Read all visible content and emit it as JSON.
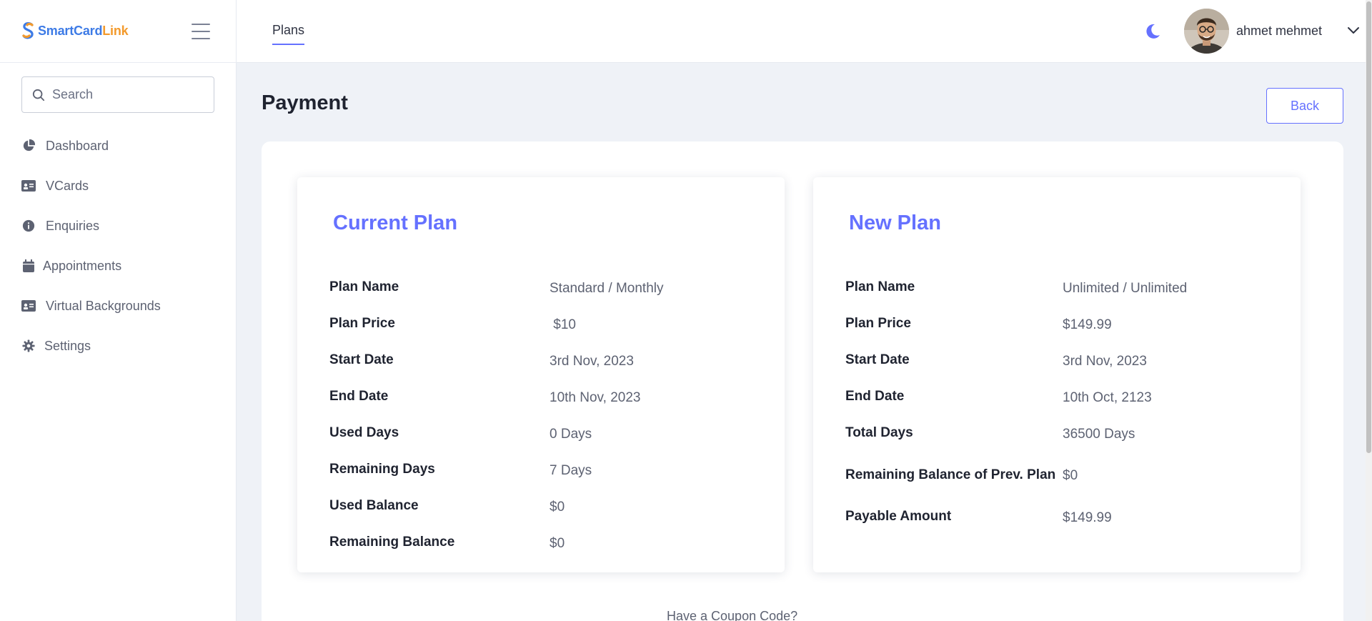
{
  "brand": {
    "part1": "Smart",
    "part2": "Card",
    "part3": "Link"
  },
  "search": {
    "placeholder": "Search"
  },
  "sidebar": {
    "items": [
      {
        "label": "Dashboard",
        "icon": "pie-chart-icon"
      },
      {
        "label": "VCards",
        "icon": "id-card-icon"
      },
      {
        "label": "Enquiries",
        "icon": "info-circle-icon"
      },
      {
        "label": "Appointments",
        "icon": "calendar-icon"
      },
      {
        "label": "Virtual Backgrounds",
        "icon": "id-card-icon"
      },
      {
        "label": "Settings",
        "icon": "gear-icon"
      }
    ]
  },
  "header": {
    "tab": "Plans",
    "user_name": "ahmet mehmet"
  },
  "page": {
    "title": "Payment",
    "back_label": "Back",
    "coupon_text": "Have a Coupon Code?"
  },
  "current_plan": {
    "title": "Current Plan",
    "rows": [
      {
        "label": "Plan Name",
        "value": "Standard / Monthly"
      },
      {
        "label": "Plan Price",
        "value": " $10"
      },
      {
        "label": "Start Date",
        "value": "3rd Nov, 2023"
      },
      {
        "label": "End Date",
        "value": "10th Nov, 2023"
      },
      {
        "label": "Used Days",
        "value": "0 Days"
      },
      {
        "label": "Remaining Days",
        "value": "7 Days"
      },
      {
        "label": "Used Balance",
        "value": "$0"
      },
      {
        "label": "Remaining Balance",
        "value": "$0"
      }
    ]
  },
  "new_plan": {
    "title": "New Plan",
    "rows": [
      {
        "label": "Plan Name",
        "value": "Unlimited / Unlimited"
      },
      {
        "label": "Plan Price",
        "value": "$149.99"
      },
      {
        "label": "Start Date",
        "value": "3rd Nov, 2023"
      },
      {
        "label": "End Date",
        "value": "10th Oct, 2123"
      },
      {
        "label": "Total Days",
        "value": "36500 Days"
      },
      {
        "label": "Remaining Balance of Prev. Plan",
        "value": "$0"
      },
      {
        "label": "Payable Amount",
        "value": "$149.99"
      }
    ]
  },
  "colors": {
    "accent": "#6571ff",
    "background": "#eff2f7"
  }
}
